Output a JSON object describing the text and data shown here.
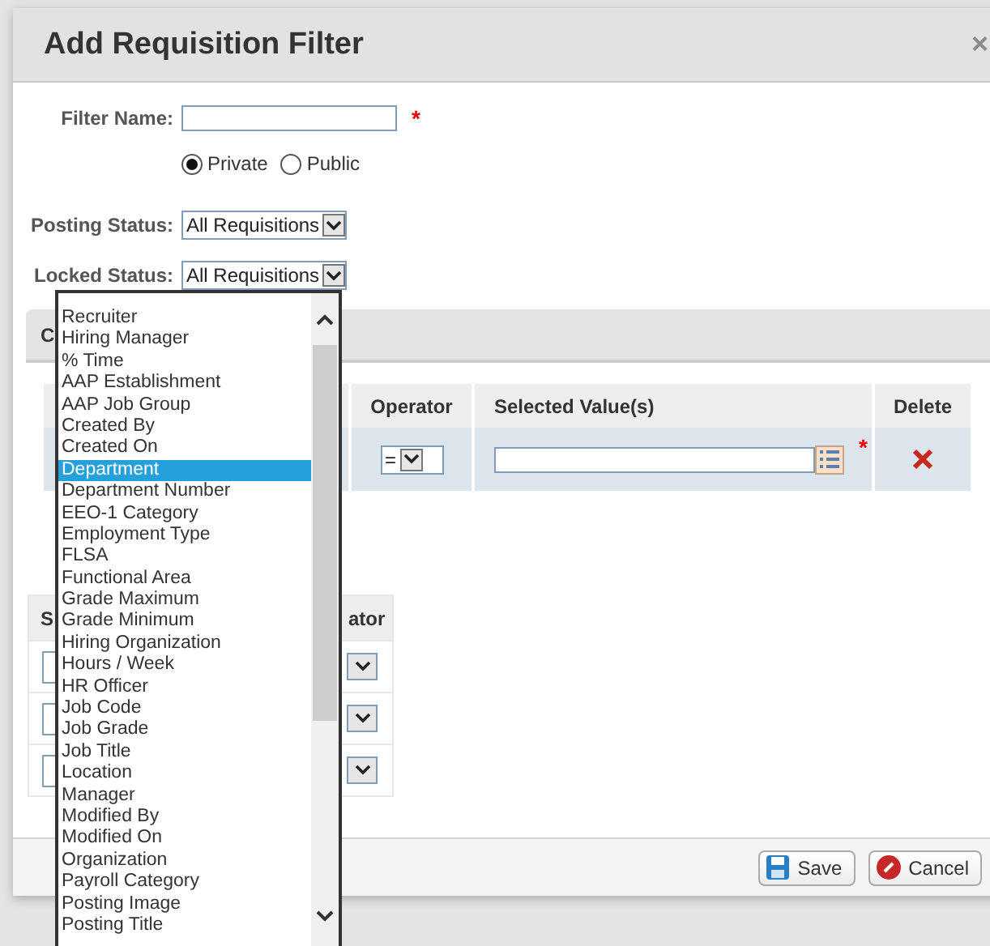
{
  "dialog": {
    "title": "Add Requisition Filter",
    "close": "×"
  },
  "filter_name": {
    "label": "Filter Name:",
    "required_mark": "*"
  },
  "visibility": [
    {
      "label": "Private",
      "selected": true
    },
    {
      "label": "Public",
      "selected": false
    }
  ],
  "posting_status": {
    "label": "Posting Status:",
    "value": "All Requisitions"
  },
  "locked_status": {
    "label": "Locked Status:",
    "value": "All Requisitions"
  },
  "section": {
    "title": "C"
  },
  "criteria_table": {
    "columns": [
      "Operator",
      "Selected Value(s)",
      "Delete"
    ],
    "rows": [
      {
        "operator": "=",
        "required_mark": "*"
      }
    ]
  },
  "second_table": {
    "columns": [
      "S",
      "ator"
    ],
    "rows": [
      {
        "kind": "select"
      },
      {
        "kind": "select"
      },
      {
        "kind": "select"
      }
    ]
  },
  "buttons": [
    {
      "label": "Save",
      "kind": "save"
    },
    {
      "label": "Cancel",
      "kind": "cancel"
    }
  ],
  "dropdown": {
    "options": [
      {
        "label": "Recruiter",
        "selected": false
      },
      {
        "label": "Hiring Manager",
        "selected": false
      },
      {
        "label": "% Time",
        "selected": false
      },
      {
        "label": "AAP Establishment",
        "selected": false
      },
      {
        "label": "AAP Job Group",
        "selected": false
      },
      {
        "label": "Created By",
        "selected": false
      },
      {
        "label": "Created On",
        "selected": false
      },
      {
        "label": "Department",
        "selected": true
      },
      {
        "label": "Department Number",
        "selected": false
      },
      {
        "label": "EEO-1 Category",
        "selected": false
      },
      {
        "label": "Employment Type",
        "selected": false
      },
      {
        "label": "FLSA",
        "selected": false
      },
      {
        "label": "Functional Area",
        "selected": false
      },
      {
        "label": "Grade Maximum",
        "selected": false
      },
      {
        "label": "Grade Minimum",
        "selected": false
      },
      {
        "label": "Hiring Organization",
        "selected": false
      },
      {
        "label": "Hours / Week",
        "selected": false
      },
      {
        "label": "HR Officer",
        "selected": false
      },
      {
        "label": "Job Code",
        "selected": false
      },
      {
        "label": "Job Grade",
        "selected": false
      },
      {
        "label": "Job Title",
        "selected": false
      },
      {
        "label": "Location",
        "selected": false
      },
      {
        "label": "Manager",
        "selected": false
      },
      {
        "label": "Modified By",
        "selected": false
      },
      {
        "label": "Modified On",
        "selected": false
      },
      {
        "label": "Organization",
        "selected": false
      },
      {
        "label": "Payroll Category",
        "selected": false
      },
      {
        "label": "Posting Image",
        "selected": false
      },
      {
        "label": "Posting Title",
        "selected": false
      }
    ]
  }
}
